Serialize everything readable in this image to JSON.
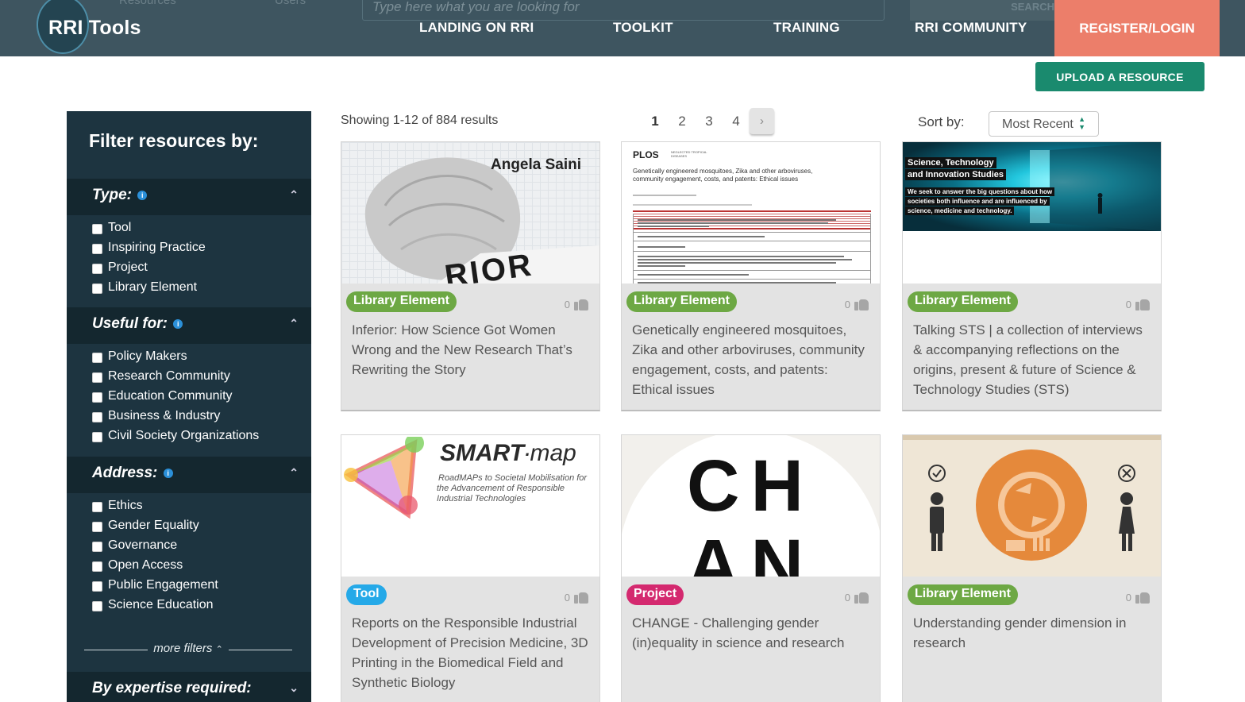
{
  "header": {
    "ghost_nav": [
      "Resources",
      "Users"
    ],
    "ghost_search_placeholder": "Type here what you are looking for",
    "ghost_search_button": "SEARCH",
    "logo": "RRI Tools",
    "nav": [
      "LANDING ON RRI",
      "TOOLKIT",
      "TRAINING",
      "RRI COMMUNITY"
    ],
    "register": "REGISTER/LOGIN"
  },
  "upload_label": "UPLOAD A RESOURCE",
  "sidebar": {
    "title": "Filter resources by:",
    "sections": [
      {
        "label": "Type:",
        "options": [
          "Tool",
          "Inspiring Practice",
          "Project",
          "Library Element"
        ]
      },
      {
        "label": "Useful for:",
        "options": [
          "Policy Makers",
          "Research Community",
          "Education Community",
          "Business & Industry",
          "Civil Society Organizations"
        ]
      },
      {
        "label": "Address:",
        "options": [
          "Ethics",
          "Gender Equality",
          "Governance",
          "Open Access",
          "Public Engagement",
          "Science Education"
        ]
      }
    ],
    "more_filters": "more filters",
    "expertise": "By expertise required:"
  },
  "toolbar": {
    "results_text": "Showing 1-12 of 884 results",
    "pages": [
      "1",
      "2",
      "3",
      "4"
    ],
    "next": "›",
    "sort_label": "Sort by:",
    "sort_value": "Most Recent"
  },
  "cards": [
    {
      "type": "Library Element",
      "likes": "0",
      "title": "Inferior: How Science Got Women Wrong and the New Research That’s Rewriting the Story",
      "img_text": [
        "Angela Saini",
        "RIOR"
      ]
    },
    {
      "type": "Library Element",
      "likes": "0",
      "title": "Genetically engineered mosquitoes, Zika and other arboviruses, community engagement, costs, and patents: Ethical issues",
      "img_text": [
        "PLOS",
        "NEGLECTED TROPICAL DISEASES",
        "Genetically engineered mosquitoes, Zika and other arboviruses, community engagement, costs, and patents: Ethical issues"
      ]
    },
    {
      "type": "Library Element",
      "likes": "0",
      "title": "Talking STS | a collection of interviews & accompanying reflections on the origins, present & future of Science & Technology Studies (STS)",
      "img_text": [
        "Science, Technology",
        "and Innovation Studies",
        "We seek to answer the big questions about how",
        "societies both influence and are influenced by",
        "science, medicine and technology."
      ]
    },
    {
      "type": "Tool",
      "likes": "0",
      "title": "Reports on the Responsible Industrial Development of Precision Medicine, 3D Printing in the Biomedical Field and Synthetic Biology",
      "img_text": [
        "SMART",
        "map",
        "RoadMAPs to Societal Mobilisation for",
        "the Advancement of Responsible",
        "Industrial Technologies"
      ]
    },
    {
      "type": "Project",
      "likes": "0",
      "title": "CHANGE - Challenging gender (in)equality in science and research",
      "img_text": [
        "CH",
        "AN"
      ]
    },
    {
      "type": "Library Element",
      "likes": "0",
      "title": "Understanding gender dimension in research",
      "img_text": []
    }
  ]
}
